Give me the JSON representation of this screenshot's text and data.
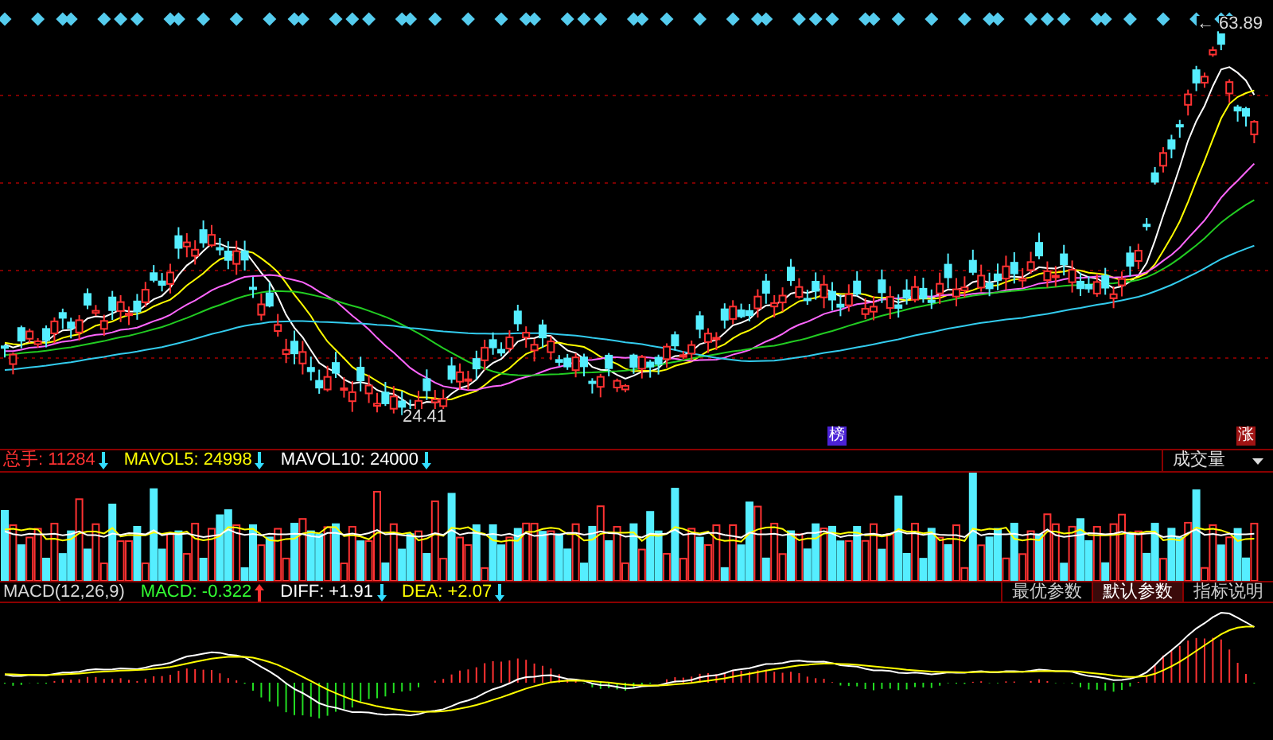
{
  "price_panel": {
    "high_arrow": "←",
    "high_label": "63.89",
    "low_label": "24.41",
    "badges": [
      {
        "text": "榜",
        "color": "#4b22d6"
      },
      {
        "text": "涨",
        "color": "#a01414"
      }
    ]
  },
  "volume_legend": [
    {
      "label": "总手: 11284",
      "arrow": {
        "rising": false,
        "color": "#33ddff"
      },
      "color": "#ff3232"
    },
    {
      "label": "MAVOL5: 24998",
      "arrow": {
        "rising": false,
        "color": "#33ddff"
      },
      "color": "#ffff00"
    },
    {
      "label": "MAVOL10: 24000",
      "arrow": {
        "rising": false,
        "color": "#33ddff"
      },
      "color": "#ffffff"
    }
  ],
  "volume_selector": {
    "value": "成交量"
  },
  "macd_legend": [
    {
      "label": "MACD(12,26,9)",
      "color": "#d8d8d8"
    },
    {
      "label": "MACD: -0.322",
      "arrow": {
        "rising": true,
        "color": "#ff3232"
      },
      "color": "#33ff33"
    },
    {
      "label": "DIFF: +1.91",
      "arrow": {
        "rising": false,
        "color": "#33ddff"
      },
      "color": "#ffffff"
    },
    {
      "label": "DEA: +2.07",
      "arrow": {
        "rising": false,
        "color": "#33ddff"
      },
      "color": "#ffff00"
    }
  ],
  "macd_buttons": [
    {
      "label": "最优参数",
      "selected": false
    },
    {
      "label": "默认参数",
      "selected": true
    },
    {
      "label": "指标说明",
      "selected": false
    }
  ]
}
